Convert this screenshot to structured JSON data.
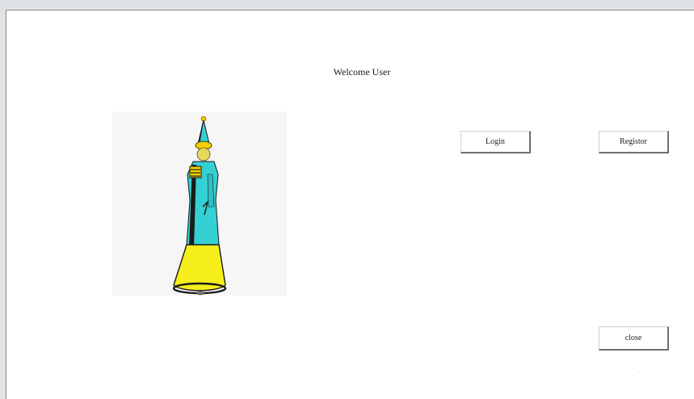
{
  "window": {
    "welcome_text": "Welcome User"
  },
  "buttons": {
    "login_label": "Login",
    "register_label": "Registor",
    "close_label": "close"
  },
  "illustration": {
    "icon": "robot-figure-illustration",
    "colors": {
      "coat": "#35d0d4",
      "skirt": "#f5ee1a",
      "hat_band": "#f5d000",
      "outline": "#1a1a1a"
    }
  }
}
